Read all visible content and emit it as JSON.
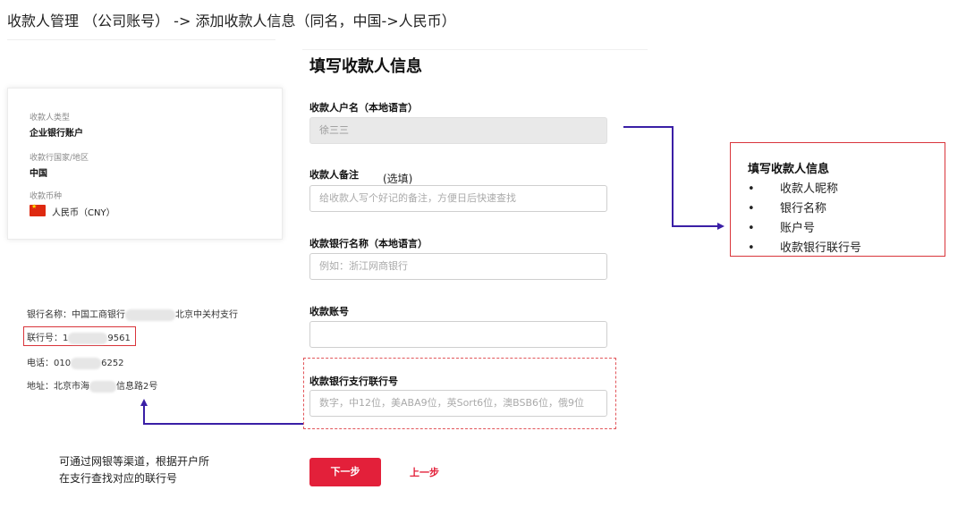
{
  "slide": {
    "title": "收款人管理 （公司账号） -> 添加收款人信息（同名，中国->人民币）"
  },
  "summary_card": {
    "payee_type_label": "收款人类型",
    "payee_type_value": "企业银行账户",
    "country_label": "收款行国家/地区",
    "country_value": "中国",
    "currency_label": "收款币种",
    "currency_value": "人民币（CNY）"
  },
  "bank_info": {
    "name_prefix": "银行名称：中国工商银行",
    "name_suffix": "北京中关村支行",
    "code_prefix": "联行号：1",
    "code_suffix": "9561",
    "phone_prefix": "电话：010",
    "phone_suffix": "6252",
    "address_prefix": "地址：北京市海",
    "address_suffix": "信息路2号"
  },
  "form": {
    "title": "填写收款人信息",
    "account_name_label": "收款人户名（本地语言）",
    "account_name_value": "徐三三",
    "remark_label": "收款人备注",
    "remark_optional": "(选填)",
    "remark_placeholder": "给收款人写个好记的备注，方便日后快速查找",
    "bank_name_label": "收款银行名称（本地语言）",
    "bank_name_placeholder": "例如：浙江网商银行",
    "account_no_label": "收款账号",
    "account_no_value": "",
    "branch_code_label": "收款银行支行联行号",
    "branch_code_placeholder": "数字，中12位，美ABA9位，英Sort6位，澳BSB6位，俄9位",
    "next_button": "下一步",
    "prev_button": "上一步"
  },
  "callout": {
    "title": "填写收款人信息",
    "items": [
      "收款人昵称",
      "银行名称",
      "账户号",
      "收款银行联行号"
    ]
  },
  "note": {
    "line1": "可通过网银等渠道，根据开户所",
    "line2": "在支行查找对应的联行号"
  },
  "colors": {
    "accent_red": "#e3203a",
    "annotation_red": "#d9353b",
    "arrow_purple": "#3a1fa6"
  }
}
